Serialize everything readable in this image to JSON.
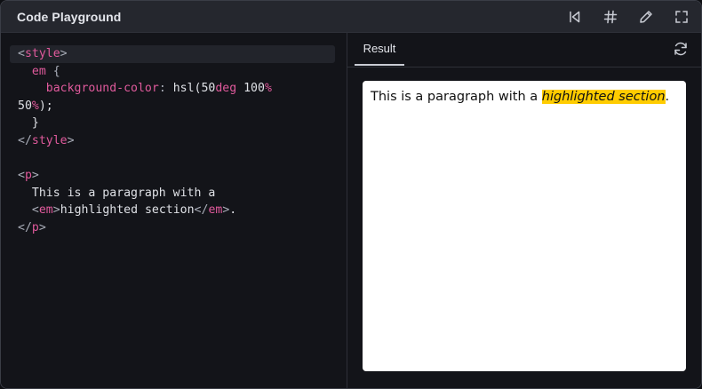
{
  "window": {
    "title": "Code Playground",
    "toolbar_icons": [
      "reset-icon",
      "hash-icon",
      "pencil-icon",
      "fullscreen-icon"
    ]
  },
  "editor": {
    "lines": [
      "<style>",
      "  em {",
      "    background-color: hsl(50deg 100%",
      "50%);",
      "  }",
      "</style>",
      "",
      "<p>",
      "  This is a paragraph with a",
      "  <em>highlighted section</em>.",
      "</p>"
    ]
  },
  "result": {
    "tab_label": "Result",
    "refresh_icon": "refresh-icon",
    "paragraph_before": "This is a paragraph with a ",
    "highlighted_text": "highlighted section",
    "paragraph_after": ".",
    "highlight_color": "#ffcc00"
  },
  "colors": {
    "tag": "#e05a9c",
    "text": "#dfe1e6",
    "titlebar": "#25272e",
    "background": "#131419"
  }
}
